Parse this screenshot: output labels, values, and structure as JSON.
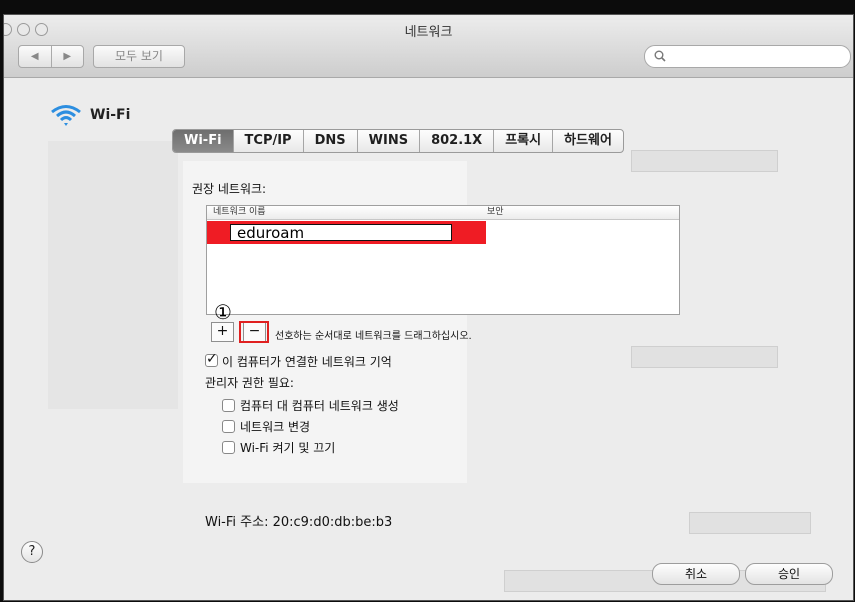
{
  "window": {
    "title": "네트워크"
  },
  "toolbar": {
    "back": "◀",
    "forward": "▶",
    "show_all": "모두 보기"
  },
  "search": {
    "placeholder": ""
  },
  "header": {
    "service": "Wi-Fi"
  },
  "tabs": [
    {
      "label": "Wi-Fi",
      "active": true
    },
    {
      "label": "TCP/IP",
      "active": false
    },
    {
      "label": "DNS",
      "active": false
    },
    {
      "label": "WINS",
      "active": false
    },
    {
      "label": "802.1X",
      "active": false
    },
    {
      "label": "프록시",
      "active": false
    },
    {
      "label": "하드웨어",
      "active": false
    }
  ],
  "preferred": {
    "title": "권장 네트워크:",
    "col_name": "네트워크 이름",
    "col_security": "보안",
    "networks": [
      {
        "name": "eduroam",
        "security": ""
      }
    ]
  },
  "list_controls": {
    "add": "+",
    "remove": "−",
    "hint": "선호하는 순서대로 네트워크를 드래그하십시오.",
    "annotation": "①"
  },
  "options": {
    "remember": {
      "label": "이 컴퓨터가 연결한 네트워크 기억",
      "checked": true
    },
    "admin_title": "관리자 권한 필요:",
    "items": [
      {
        "label": "컴퓨터 대 컴퓨터 네트워크 생성",
        "checked": false
      },
      {
        "label": "네트워크 변경",
        "checked": false
      },
      {
        "label": "Wi-Fi 켜기 및 끄기",
        "checked": false
      }
    ]
  },
  "address": {
    "label": "Wi-Fi 주소:",
    "value": "20:c9:d0:db:be:b3"
  },
  "footer": {
    "help": "?",
    "cancel": "취소",
    "ok": "승인"
  },
  "colors": {
    "highlight": "#ef1c24",
    "active_tab": "#7a7a7a"
  }
}
